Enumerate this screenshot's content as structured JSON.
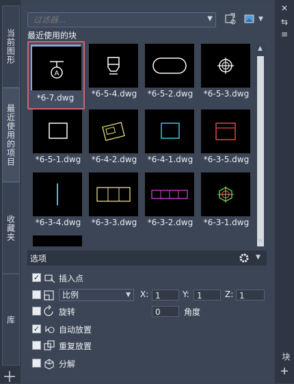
{
  "vertical_tabs": [
    "当前图形",
    "最近使用的项目",
    "收藏夹",
    "库"
  ],
  "right_strip_bottom": "块",
  "filter": {
    "placeholder": "过滤器..."
  },
  "section_title": "最近使用的块",
  "blocks": [
    {
      "label": "*6-7.dwg",
      "selected": true,
      "icon": "circle-a-symbol"
    },
    {
      "label": "*6-5-4.dwg",
      "icon": "box-symbol"
    },
    {
      "label": "*6-5-2.dwg",
      "icon": "rounded-slot-symbol"
    },
    {
      "label": "*6-5-3.dwg",
      "icon": "crosshair-circle-symbol"
    },
    {
      "label": "*6-5-1.dwg",
      "icon": "square-symbol"
    },
    {
      "label": "*6-4-2.dwg",
      "icon": "rotated-rect-symbol"
    },
    {
      "label": "*6-4-1.dwg",
      "icon": "cyan-square-symbol"
    },
    {
      "label": "*6-3-5.dwg",
      "icon": "red-box-symbol"
    },
    {
      "label": "*6-3-4.dwg",
      "icon": "cyan-line-symbol"
    },
    {
      "label": "*6-3-3.dwg",
      "icon": "yellow-bar-symbol"
    },
    {
      "label": "*6-3-2.dwg",
      "icon": "magenta-bar-symbol"
    },
    {
      "label": "*6-3-1.dwg",
      "icon": "green-hexagon-symbol"
    }
  ],
  "options": {
    "title": "选项",
    "insert_point": {
      "label": "插入点",
      "checked": true
    },
    "scale": {
      "checked": false,
      "mode": "比例",
      "x_label": "X:",
      "x": "1",
      "y_label": "Y:",
      "y": "1",
      "z_label": "Z:",
      "z": "1"
    },
    "rotate": {
      "label": "旋转",
      "checked": false,
      "value": "0",
      "unit": "角度"
    },
    "auto_place": {
      "label": "自动放置",
      "checked": true
    },
    "repeat_place": {
      "label": "重复放置",
      "checked": false
    },
    "explode": {
      "label": "分解",
      "checked": false
    }
  }
}
